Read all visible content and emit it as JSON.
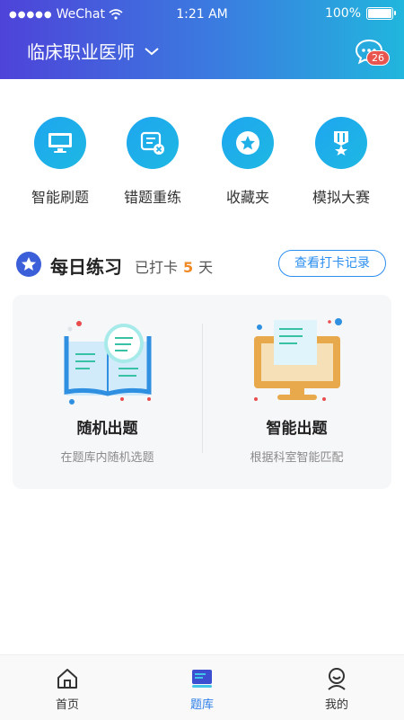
{
  "status_bar": {
    "carrier": "WeChat",
    "time": "1:21 AM",
    "battery": "100%"
  },
  "header": {
    "title": "临床职业医师",
    "message_badge": "26"
  },
  "quick_actions": [
    {
      "label": "智能刷题",
      "icon": "monitor-icon"
    },
    {
      "label": "错题重练",
      "icon": "wrong-question-icon"
    },
    {
      "label": "收藏夹",
      "icon": "star-icon"
    },
    {
      "label": "模拟大赛",
      "icon": "medal-icon"
    }
  ],
  "daily": {
    "title": "每日练习",
    "checked_prefix": "已打卡",
    "checked_days": "5",
    "checked_suffix": "天",
    "record_button": "查看打卡记录"
  },
  "practice_options": [
    {
      "title": "随机出题",
      "desc": "在题库内随机选题",
      "icon": "book-magnifier-icon"
    },
    {
      "title": "智能出题",
      "desc": "根据科室智能匹配",
      "icon": "computer-icon"
    }
  ],
  "tabbar": [
    {
      "label": "首页",
      "icon": "home-icon",
      "active": false
    },
    {
      "label": "题库",
      "icon": "question-bank-icon",
      "active": true
    },
    {
      "label": "我的",
      "icon": "profile-icon",
      "active": false
    }
  ],
  "colors": {
    "primary": "#2b7de9",
    "accent": "#f08a24",
    "badge": "#e8554e"
  }
}
